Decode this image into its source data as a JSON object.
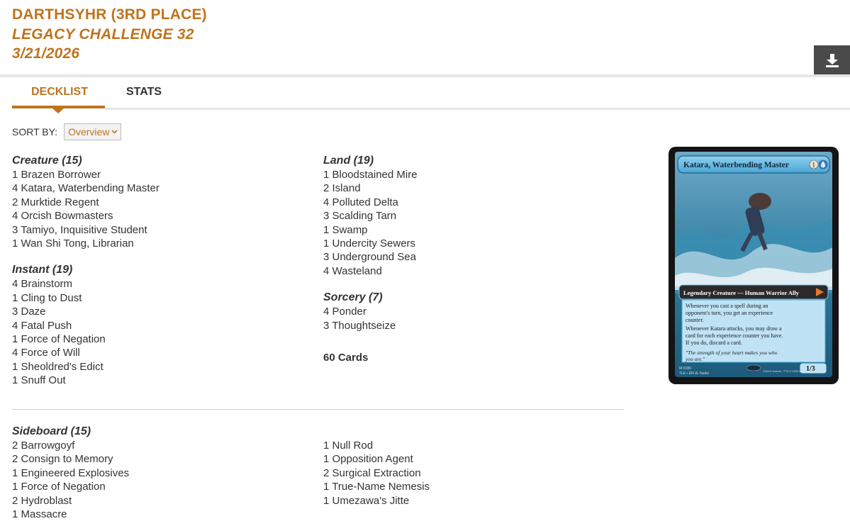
{
  "header": {
    "player": "DARTHSYHR (3RD PLACE)",
    "event": "LEGACY CHALLENGE 32",
    "date": "3/21/2026"
  },
  "tabs": [
    {
      "label": "DECKLIST",
      "active": true
    },
    {
      "label": "STATS",
      "active": false
    }
  ],
  "sort": {
    "label": "SORT BY:",
    "selected": "Overview"
  },
  "main_left": [
    {
      "category": "Creature (15)",
      "cards": [
        "1 Brazen Borrower",
        "4 Katara, Waterbending Master",
        "2 Murktide Regent",
        "4 Orcish Bowmasters",
        "3 Tamiyo, Inquisitive Student",
        "1 Wan Shi Tong, Librarian"
      ]
    },
    {
      "category": "Instant (19)",
      "cards": [
        "4 Brainstorm",
        "1 Cling to Dust",
        "3 Daze",
        "4 Fatal Push",
        "1 Force of Negation",
        "4 Force of Will",
        "1 Sheoldred's Edict",
        "1 Snuff Out"
      ]
    }
  ],
  "main_right": [
    {
      "category": "Land (19)",
      "cards": [
        "1 Bloodstained Mire",
        "2 Island",
        "4 Polluted Delta",
        "3 Scalding Tarn",
        "1 Swamp",
        "1 Undercity Sewers",
        "3 Underground Sea",
        "4 Wasteland"
      ]
    },
    {
      "category": "Sorcery (7)",
      "cards": [
        "4 Ponder",
        "3 Thoughtseize"
      ]
    }
  ],
  "total": "60 Cards",
  "sideboard": {
    "category": "Sideboard (15)",
    "left": [
      "2 Barrowgoyf",
      "2 Consign to Memory",
      "1 Engineered Explosives",
      "1 Force of Negation",
      "2 Hydroblast",
      "1 Massacre"
    ],
    "right": [
      "1 Null Rod",
      "1 Opposition Agent",
      "2 Surgical Extraction",
      "1 True-Name Nemesis",
      "1 Umezawa's Jitte"
    ]
  },
  "card_preview": {
    "name": "Katara, Waterbending Master",
    "mana_cost": "1",
    "type_line": "Legendary Creature — Human Warrior Ally",
    "rules_1": "Whenever you cast a spell during an opponent's turn, you get an experience counter.",
    "rules_2": "Whenever Katara attacks, you may draw a card for each experience counter you have. If you do, discard a card.",
    "flavor": "\"The strength of your heart makes you who you are.\"",
    "pt": "1/3",
    "collector": "M 0180",
    "set_line": "TLE • EN ⁂ Yueko",
    "copyright": "©2025 Viacom. ™ & © 2025 Wizards of the Coast"
  },
  "colors": {
    "accent": "#c0731e",
    "text": "#333333",
    "download_bg": "#4a4a4a"
  },
  "icons": {
    "download": "download-icon",
    "select": "chevron-down-icon"
  }
}
